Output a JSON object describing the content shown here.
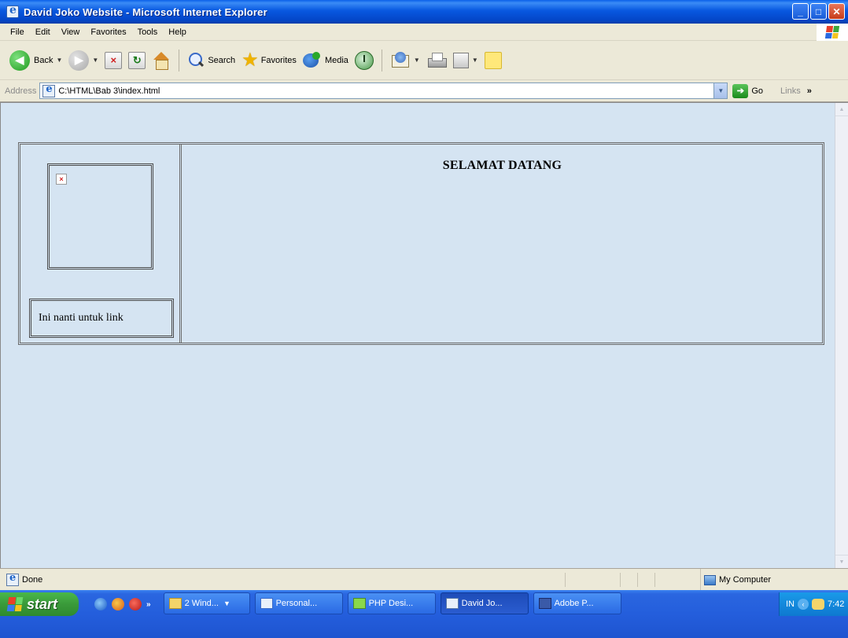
{
  "window": {
    "title": "David Joko Website - Microsoft Internet Explorer",
    "minimize": "_",
    "maximize": "□",
    "close": "✕"
  },
  "menu": {
    "items": [
      {
        "label": "File"
      },
      {
        "label": "Edit"
      },
      {
        "label": "View"
      },
      {
        "label": "Favorites"
      },
      {
        "label": "Tools"
      },
      {
        "label": "Help"
      }
    ]
  },
  "toolbar": {
    "back_label": "Back",
    "search_label": "Search",
    "favorites_label": "Favorites",
    "media_label": "Media"
  },
  "address": {
    "label": "Address",
    "value": "C:\\HTML\\Bab 3\\index.html",
    "go_label": "Go",
    "links_label": "Links",
    "links_more": "»"
  },
  "page": {
    "heading": "SELAMAT DATANG",
    "link_text": "Ini nanti untuk link",
    "broken_image_glyph": "×"
  },
  "status": {
    "text": "Done",
    "zone": "My Computer"
  },
  "taskbar": {
    "start_label": "start",
    "quick_more": "»",
    "buttons": [
      {
        "label": "2 Wind...",
        "icon": "folder-icon"
      },
      {
        "label": "Personal...",
        "icon": "word-icon"
      },
      {
        "label": "PHP Desi...",
        "icon": "php-icon"
      },
      {
        "label": "David Jo...",
        "icon": "ie-icon"
      },
      {
        "label": "Adobe P...",
        "icon": "photoshop-icon"
      }
    ],
    "tray_lang": "IN",
    "tray_clock": "7:42"
  },
  "colors": {
    "page_background": "#D5E4F2",
    "titlebar": "#0858E0",
    "taskbar": "#245EDC",
    "start_button": "#3A9A3A"
  }
}
